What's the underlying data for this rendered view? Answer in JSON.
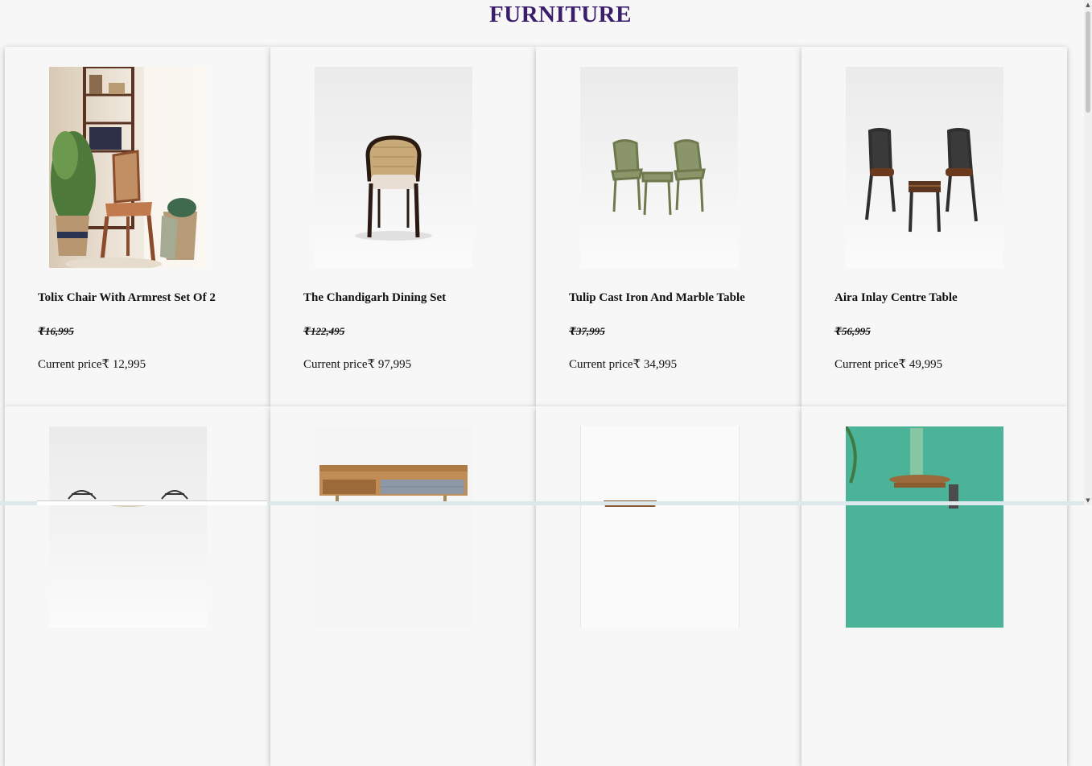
{
  "page": {
    "title": "FURNITURE"
  },
  "currency": "₹",
  "products": [
    {
      "name": "Tolix Chair With Armrest Set Of 2",
      "old_price": "₹16,995",
      "price_label": "Current price₹ 12,995",
      "image": "cane-armchair-room-photo"
    },
    {
      "name": "The Chandigarh Dining Set",
      "old_price": "₹122,495",
      "price_label": "Current price₹ 97,995",
      "image": "cane-dining-chair-photo"
    },
    {
      "name": "Tulip Cast Iron And Marble Table",
      "old_price": "₹37,995",
      "price_label": "Current price₹ 34,995",
      "image": "green-cast-iron-bistro-set-photo"
    },
    {
      "name": "Aira Inlay Centre Table",
      "old_price": "₹56,995",
      "price_label": "Current price₹ 49,995",
      "image": "metal-bar-chairs-set-photo"
    },
    {
      "name": "",
      "old_price": "",
      "price_label": "",
      "image": "wire-chairs-photo"
    },
    {
      "name": "",
      "old_price": "",
      "price_label": "",
      "image": "wooden-console-table-photo"
    },
    {
      "name": "",
      "old_price": "",
      "price_label": "",
      "image": "tray-table-photo"
    },
    {
      "name": "",
      "old_price": "",
      "price_label": "",
      "image": "round-side-table-teal-wall-photo"
    }
  ],
  "colors": {
    "title": "#3a1e6c",
    "background": "#f7f7f7"
  }
}
